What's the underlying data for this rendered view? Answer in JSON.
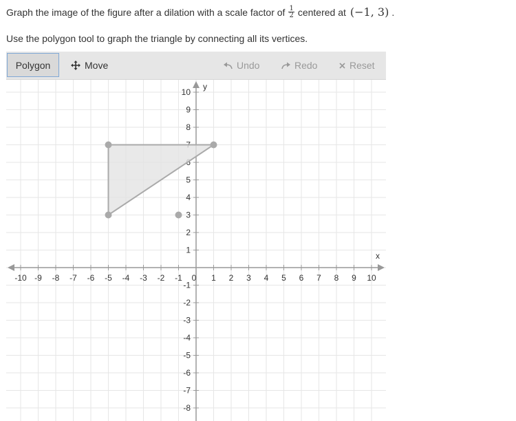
{
  "instructions": {
    "line1_before": "Graph the image of the figure after a dilation with a scale factor of",
    "scale_numerator": "1",
    "scale_denominator": "2",
    "line1_middle": "centered at",
    "center_point": "(−1, 3)",
    "line1_end": ".",
    "line2": "Use the polygon tool to graph the triangle by connecting all its vertices."
  },
  "toolbar": {
    "polygon_label": "Polygon",
    "move_label": "Move",
    "undo_label": "Undo",
    "redo_label": "Redo",
    "reset_label": "Reset",
    "icons": {
      "move": "move-arrows-icon",
      "undo": "undo-arrow-icon",
      "redo": "redo-arrow-icon",
      "reset": "x-icon"
    }
  },
  "graph": {
    "x_axis_label": "x",
    "y_axis_label": "y",
    "x_ticks": [
      -10,
      -9,
      -8,
      -7,
      -6,
      -5,
      -4,
      -3,
      -2,
      -1,
      0,
      1,
      2,
      3,
      4,
      5,
      6,
      7,
      8,
      9,
      10
    ],
    "y_ticks": [
      -8,
      -7,
      -6,
      -5,
      -4,
      -3,
      -2,
      -1,
      1,
      2,
      3,
      4,
      5,
      6,
      7,
      8,
      9,
      10
    ],
    "x_range": [
      -10,
      10
    ],
    "y_range": [
      -8,
      10
    ],
    "triangle_vertices": [
      [
        -5,
        7
      ],
      [
        1,
        7
      ],
      [
        -5,
        3
      ]
    ],
    "center_point": [
      -1,
      3
    ],
    "colors": {
      "grid": "#e6e6e6",
      "axis": "#999999",
      "polygon_fill": "#e3e3e3",
      "polygon_stroke": "#aaaaaa",
      "point": "#aaaaaa"
    }
  }
}
